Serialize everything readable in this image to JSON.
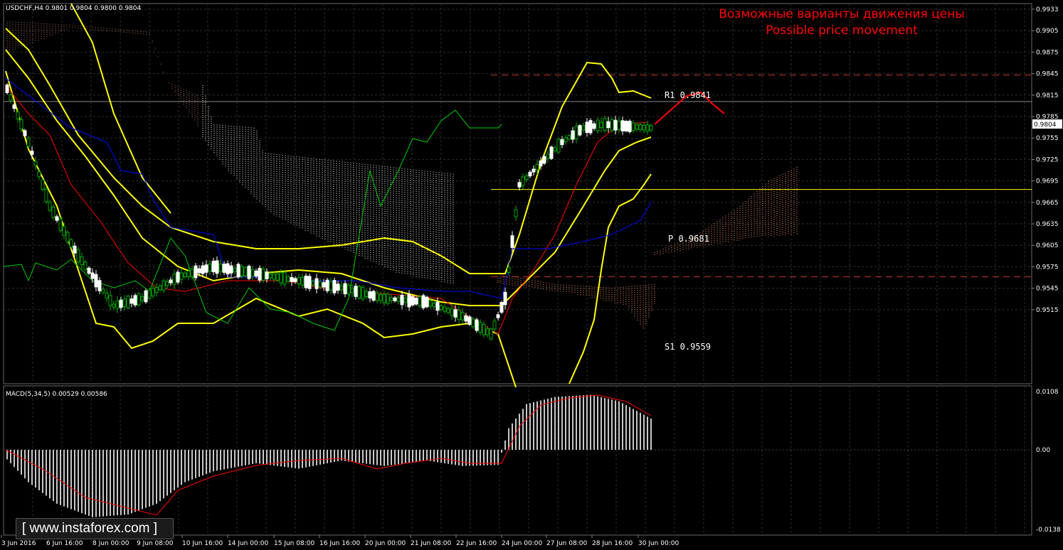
{
  "main_chart": {
    "header": "USDCHF,H4  0.9801 0.9804 0.9800 0.9804",
    "forecast_title_ru": "Возможные варианты движения цены",
    "forecast_title_en": "Possible price movement",
    "price_axis": [
      "0.9933",
      "0.9905",
      "0.9875",
      "0.9845",
      "0.9815",
      "0.9785",
      "0.9755",
      "0.9725",
      "0.9695",
      "0.9665",
      "0.9635",
      "0.9605",
      "0.9575",
      "0.9545",
      "0.9515"
    ],
    "current_price": "0.9804",
    "levels": {
      "r1": "R1  0.9841",
      "pivot": "P  0.9681",
      "s1": "S1  0.9559"
    }
  },
  "macd_panel": {
    "header": "MACD(5,34,5) 0.00529 0.00586",
    "axis": [
      "0.0108",
      "0.00",
      "-0.0138"
    ]
  },
  "time_axis": [
    "3 Jun 2016",
    "6 Jun 16:00",
    "8 Jun 00:00",
    "9 Jun 08:00",
    "10 Jun 16:00",
    "14 Jun 00:00",
    "15 Jun 08:00",
    "16 Jun 16:00",
    "20 Jun 00:00",
    "21 Jun 08:00",
    "22 Jun 16:00",
    "24 Jun 00:00",
    "27 Jun 08:00",
    "28 Jun 16:00",
    "30 Jun 00:00"
  ],
  "watermark": "[ www.instaforex.com ]",
  "colors": {
    "bollinger": "#ffff00",
    "candles_bull": "#ffffff",
    "candles_bear": "#00aa00",
    "tenkan": "#ff0000",
    "kijun": "#0000ff",
    "chikou": "#00cc00",
    "forecast": "#ff0000",
    "grid": "#2e2e2e"
  }
}
